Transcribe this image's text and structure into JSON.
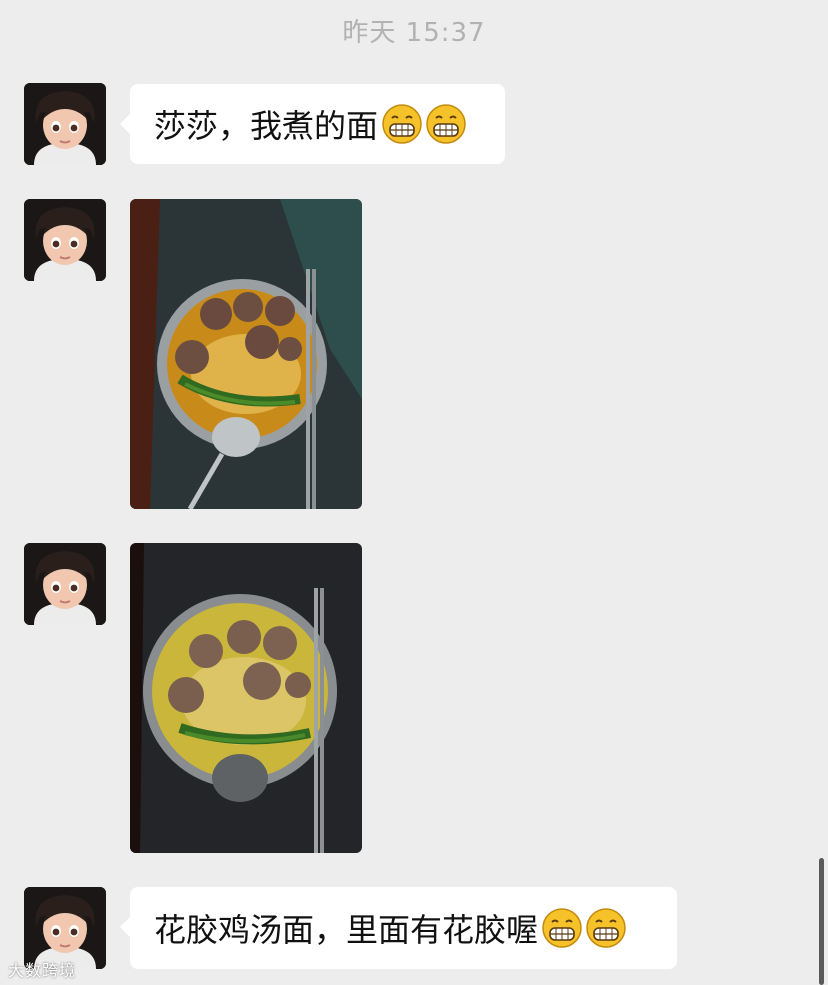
{
  "chat": {
    "timestamp": "昨天 15:37",
    "messages": [
      {
        "type": "text",
        "text": "莎莎，我煮的面",
        "emoji": [
          "grinning-face",
          "grinning-face"
        ]
      },
      {
        "type": "image",
        "description": "bowl of noodles with meatballs and greens"
      },
      {
        "type": "image",
        "description": "bowl of noodles with meatballs and greens"
      },
      {
        "type": "text",
        "text": "花胶鸡汤面，里面有花胶喔",
        "emoji": [
          "grinning-face",
          "grinning-face"
        ]
      }
    ]
  },
  "watermark": "大数跨境",
  "colors": {
    "background": "#ededed",
    "bubble": "#ffffff",
    "timestamp": "#b2b2b2"
  }
}
